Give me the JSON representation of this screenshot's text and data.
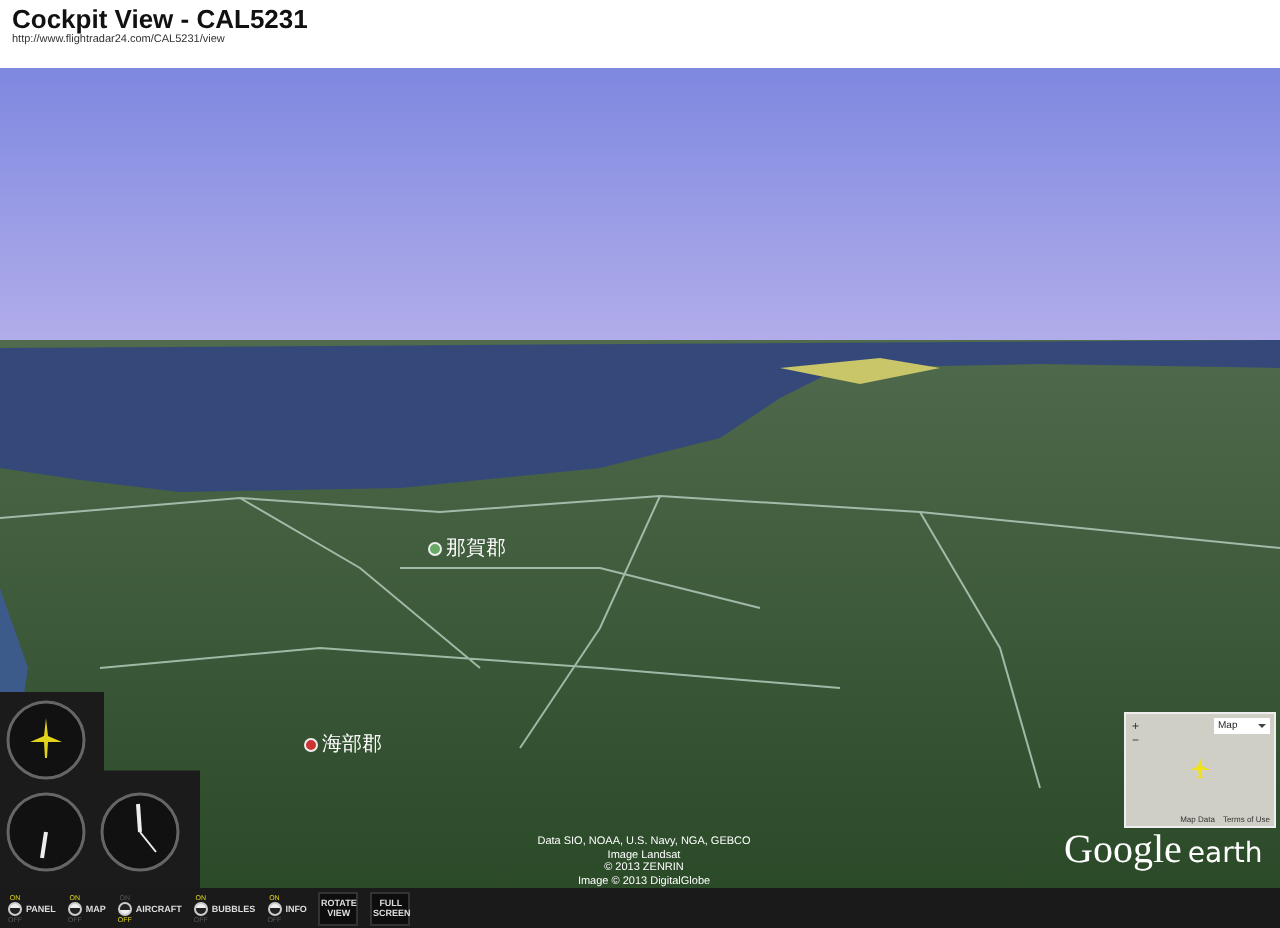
{
  "window": {
    "title": "Cockpit View - CAL5231",
    "url": "http://www.flightradar24.com/CAL5231/view"
  },
  "scene": {
    "place_labels": [
      "那賀郡",
      "海部郡"
    ],
    "attribution": [
      "Data SIO, NOAA, U.S. Navy, NGA, GEBCO",
      "Image Landsat",
      "© 2013 ZENRIN",
      "Image © 2013 DigitalGlobe"
    ],
    "logo": {
      "brand": "Google",
      "product": "earth"
    },
    "minimap": {
      "map_type": "Map",
      "zoom_in": "+",
      "zoom_out": "−",
      "links": [
        "Map Data",
        "Terms of Use"
      ]
    }
  },
  "toggles": [
    {
      "label": "PANEL",
      "on_label": "ON",
      "off_label": "OFF",
      "on": true
    },
    {
      "label": "MAP",
      "on_label": "ON",
      "off_label": "OFF",
      "on": true
    },
    {
      "label": "AIRCRAFT",
      "on_label": "ON",
      "off_label": "OFF",
      "on": false
    },
    {
      "label": "BUBBLES",
      "on_label": "ON",
      "off_label": "OFF",
      "on": true
    },
    {
      "label": "INFO",
      "on_label": "ON",
      "off_label": "OFF",
      "on": true
    }
  ],
  "buttons": [
    {
      "label": "ROTATE VIEW"
    },
    {
      "label": "FULL SCREEN"
    }
  ]
}
